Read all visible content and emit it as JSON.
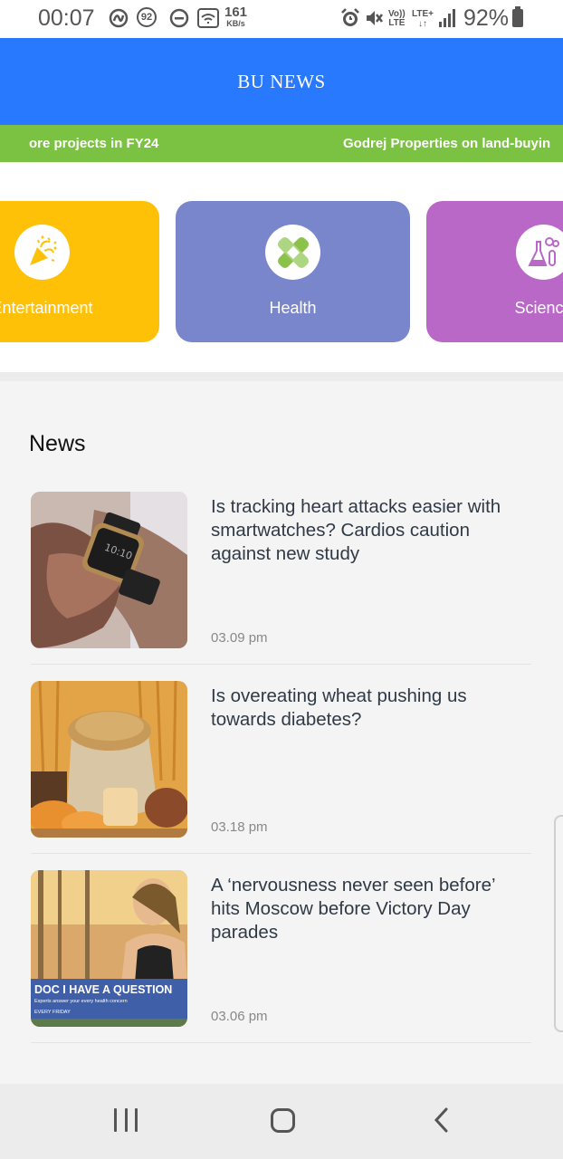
{
  "status_bar": {
    "time": "00:07",
    "badge_count": "92",
    "net_speed_value": "161",
    "net_speed_unit": "KB/s",
    "volte_top": "Vo))",
    "volte_bottom": "LTE",
    "lte_plus": "LTE+",
    "battery_percent": "92%"
  },
  "app_bar": {
    "title": "BU NEWS"
  },
  "ticker": {
    "items": [
      "ore projects in FY24",
      "Godrej Properties on land-buyin"
    ]
  },
  "categories": [
    {
      "label": "Entertainment",
      "color": "#ffc107",
      "icon": "party-popper-icon"
    },
    {
      "label": "Health",
      "color": "#7986cb",
      "icon": "bandage-icon"
    },
    {
      "label": "Science",
      "color": "#ba68c8",
      "icon": "flask-icon"
    }
  ],
  "news": {
    "section_title": "News",
    "items": [
      {
        "headline": "Is tracking heart attacks easier with smartwatches? Cardios caution against new study",
        "time": "03.09 pm",
        "thumb_watch_time": "10:10"
      },
      {
        "headline": "Is overeating wheat pushing us towards diabetes?",
        "time": "03.18 pm"
      },
      {
        "headline": "A ‘nervousness never seen before’ hits Moscow before Victory Day parades",
        "time": "03.06 pm",
        "thumb_banner_title": "DOC I HAVE A QUESTION",
        "thumb_banner_sub": "Experts answer your every health concern",
        "thumb_banner_foot": "EVERY FRIDAY"
      }
    ]
  },
  "colors": {
    "app_bar": "#2979ff",
    "ticker": "#7cc242"
  }
}
